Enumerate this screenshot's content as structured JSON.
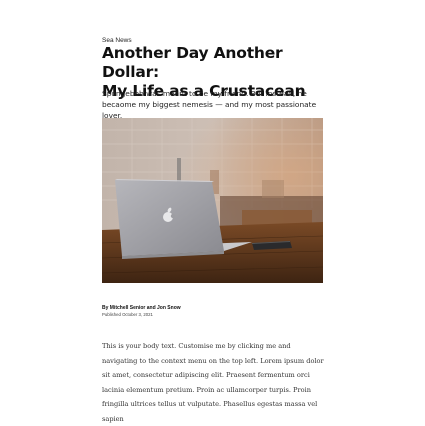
{
  "article": {
    "kicker": "Sea News",
    "title_line1": "Another Day Another Dollar:",
    "title_line2": "My Life as a Crustacean",
    "subtitle": "Spongebob was meant to be my friend. But instead, he becaome my biggest nemesis — and my most passionate lover.",
    "byline_prefix": "By",
    "authors": "Mitchell Senior and Jon Snow",
    "published": "Published October 3, 2021",
    "body": "This is your body text. Customise me by clicking me and navigating to the context menu on the top left. Lorem ipsum dolor sit amet, consectetur adipiscing elit. Praesent fermentum orci lacinia elementum pretium. Proin ac ullamcorper turpis. Proin fringilla ultrices tellus ut vulputate. Phasellus egestas massa vel sapien"
  },
  "hero_image": {
    "icon": "laptop-on-wooden-table-photo"
  }
}
